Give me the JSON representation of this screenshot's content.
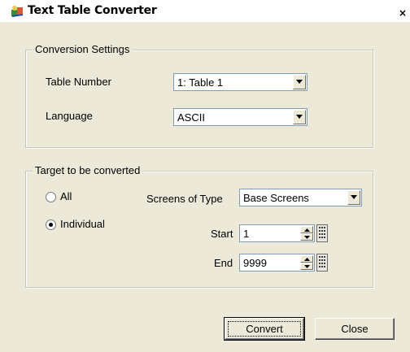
{
  "window": {
    "title": "Text Table Converter",
    "close_glyph": "×"
  },
  "conversion_settings": {
    "legend": "Conversion Settings",
    "table_number": {
      "label": "Table Number",
      "value": "1: Table 1"
    },
    "language": {
      "label": "Language",
      "value": "ASCII"
    }
  },
  "target": {
    "legend": "Target to be converted",
    "all_label": "All",
    "individual_label": "Individual",
    "selected": "Individual",
    "screens_type": {
      "label": "Screens of Type",
      "value": "Base Screens"
    },
    "start": {
      "label": "Start",
      "value": "1"
    },
    "end": {
      "label": "End",
      "value": "9999"
    }
  },
  "buttons": {
    "convert": "Convert",
    "close": "Close"
  },
  "icons": {
    "app": "app-icon",
    "dropdown": "chevron-down-icon",
    "keypad": "keypad-icon"
  }
}
